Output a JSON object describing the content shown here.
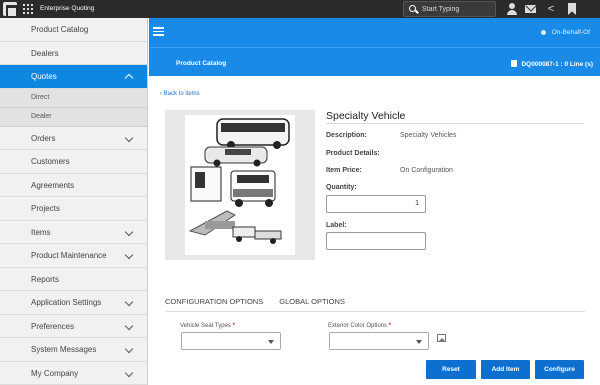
{
  "topbar": {
    "app_title": "Enterprise Quoting",
    "search_placeholder": "Start Typing"
  },
  "sidebar": {
    "items": [
      {
        "label": "Product Catalog",
        "has_chevron": false
      },
      {
        "label": "Dealers",
        "has_chevron": false
      },
      {
        "label": "Quotes",
        "has_chevron": true,
        "active": true,
        "children": [
          {
            "label": "Direct"
          },
          {
            "label": "Dealer"
          }
        ]
      },
      {
        "label": "Orders",
        "has_chevron": true
      },
      {
        "label": "Customers",
        "has_chevron": false
      },
      {
        "label": "Agreements",
        "has_chevron": false
      },
      {
        "label": "Projects",
        "has_chevron": false
      },
      {
        "label": "Items",
        "has_chevron": true
      },
      {
        "label": "Product Maintenance",
        "has_chevron": true
      },
      {
        "label": "Reports",
        "has_chevron": false
      },
      {
        "label": "Application Settings",
        "has_chevron": true
      },
      {
        "label": "Preferences",
        "has_chevron": true
      },
      {
        "label": "System Messages",
        "has_chevron": true
      },
      {
        "label": "My Company",
        "has_chevron": true
      }
    ]
  },
  "header": {
    "on_behalf_of": "On-Behalf-Of",
    "breadcrumb": "Product Catalog",
    "cart": "DQ000087-1 : 0 Line (s)",
    "accent_color": "#1a8ae8"
  },
  "main": {
    "back_link": "‹ Back to items",
    "product_title": "Specialty Vehicle",
    "description_label": "Description:",
    "description_value": "Specialty Vehicles",
    "details_label": "Product Details:",
    "price_label": "Item Price:",
    "price_value": "On Configuration",
    "quantity_label": "Quantity:",
    "quantity_value": "1",
    "label_label": "Label:",
    "label_value": "",
    "tabs": [
      "CONFIGURATION OPTIONS",
      "GLOBAL OPTIONS"
    ],
    "seat_types_label": "Vehicle Seat Types",
    "color_options_label": "Exterior Color Options",
    "required_marker": "*",
    "buttons": {
      "reset": "Reset",
      "add_item": "Add Item",
      "configure": "Configure"
    }
  }
}
